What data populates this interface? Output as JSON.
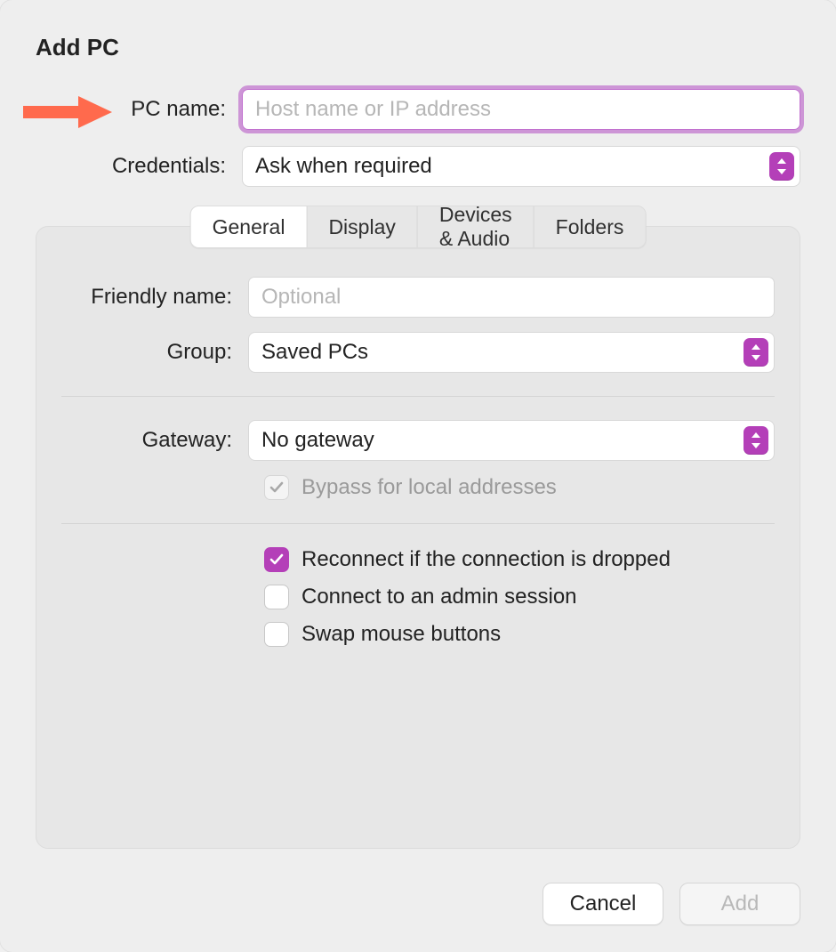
{
  "title": "Add PC",
  "top": {
    "pc_name_label": "PC name:",
    "pc_name_placeholder": "Host name or IP address",
    "pc_name_value": "",
    "credentials_label": "Credentials:",
    "credentials_value": "Ask when required"
  },
  "tabs": {
    "general": "General",
    "display": "Display",
    "devices": "Devices & Audio",
    "folders": "Folders",
    "active": "general"
  },
  "general": {
    "friendly_label": "Friendly name:",
    "friendly_placeholder": "Optional",
    "friendly_value": "",
    "group_label": "Group:",
    "group_value": "Saved PCs",
    "gateway_label": "Gateway:",
    "gateway_value": "No gateway",
    "bypass_label": "Bypass for local addresses",
    "bypass_checked": true,
    "bypass_disabled": true,
    "reconnect_label": "Reconnect if the connection is dropped",
    "reconnect_checked": true,
    "admin_label": "Connect to an admin session",
    "admin_checked": false,
    "swap_label": "Swap mouse buttons",
    "swap_checked": false
  },
  "footer": {
    "cancel": "Cancel",
    "add": "Add",
    "add_disabled": true
  },
  "colors": {
    "accent": "#b43fb8",
    "focus_ring": "rgba(178,76,195,.55)",
    "arrow": "#ff6a4d"
  }
}
